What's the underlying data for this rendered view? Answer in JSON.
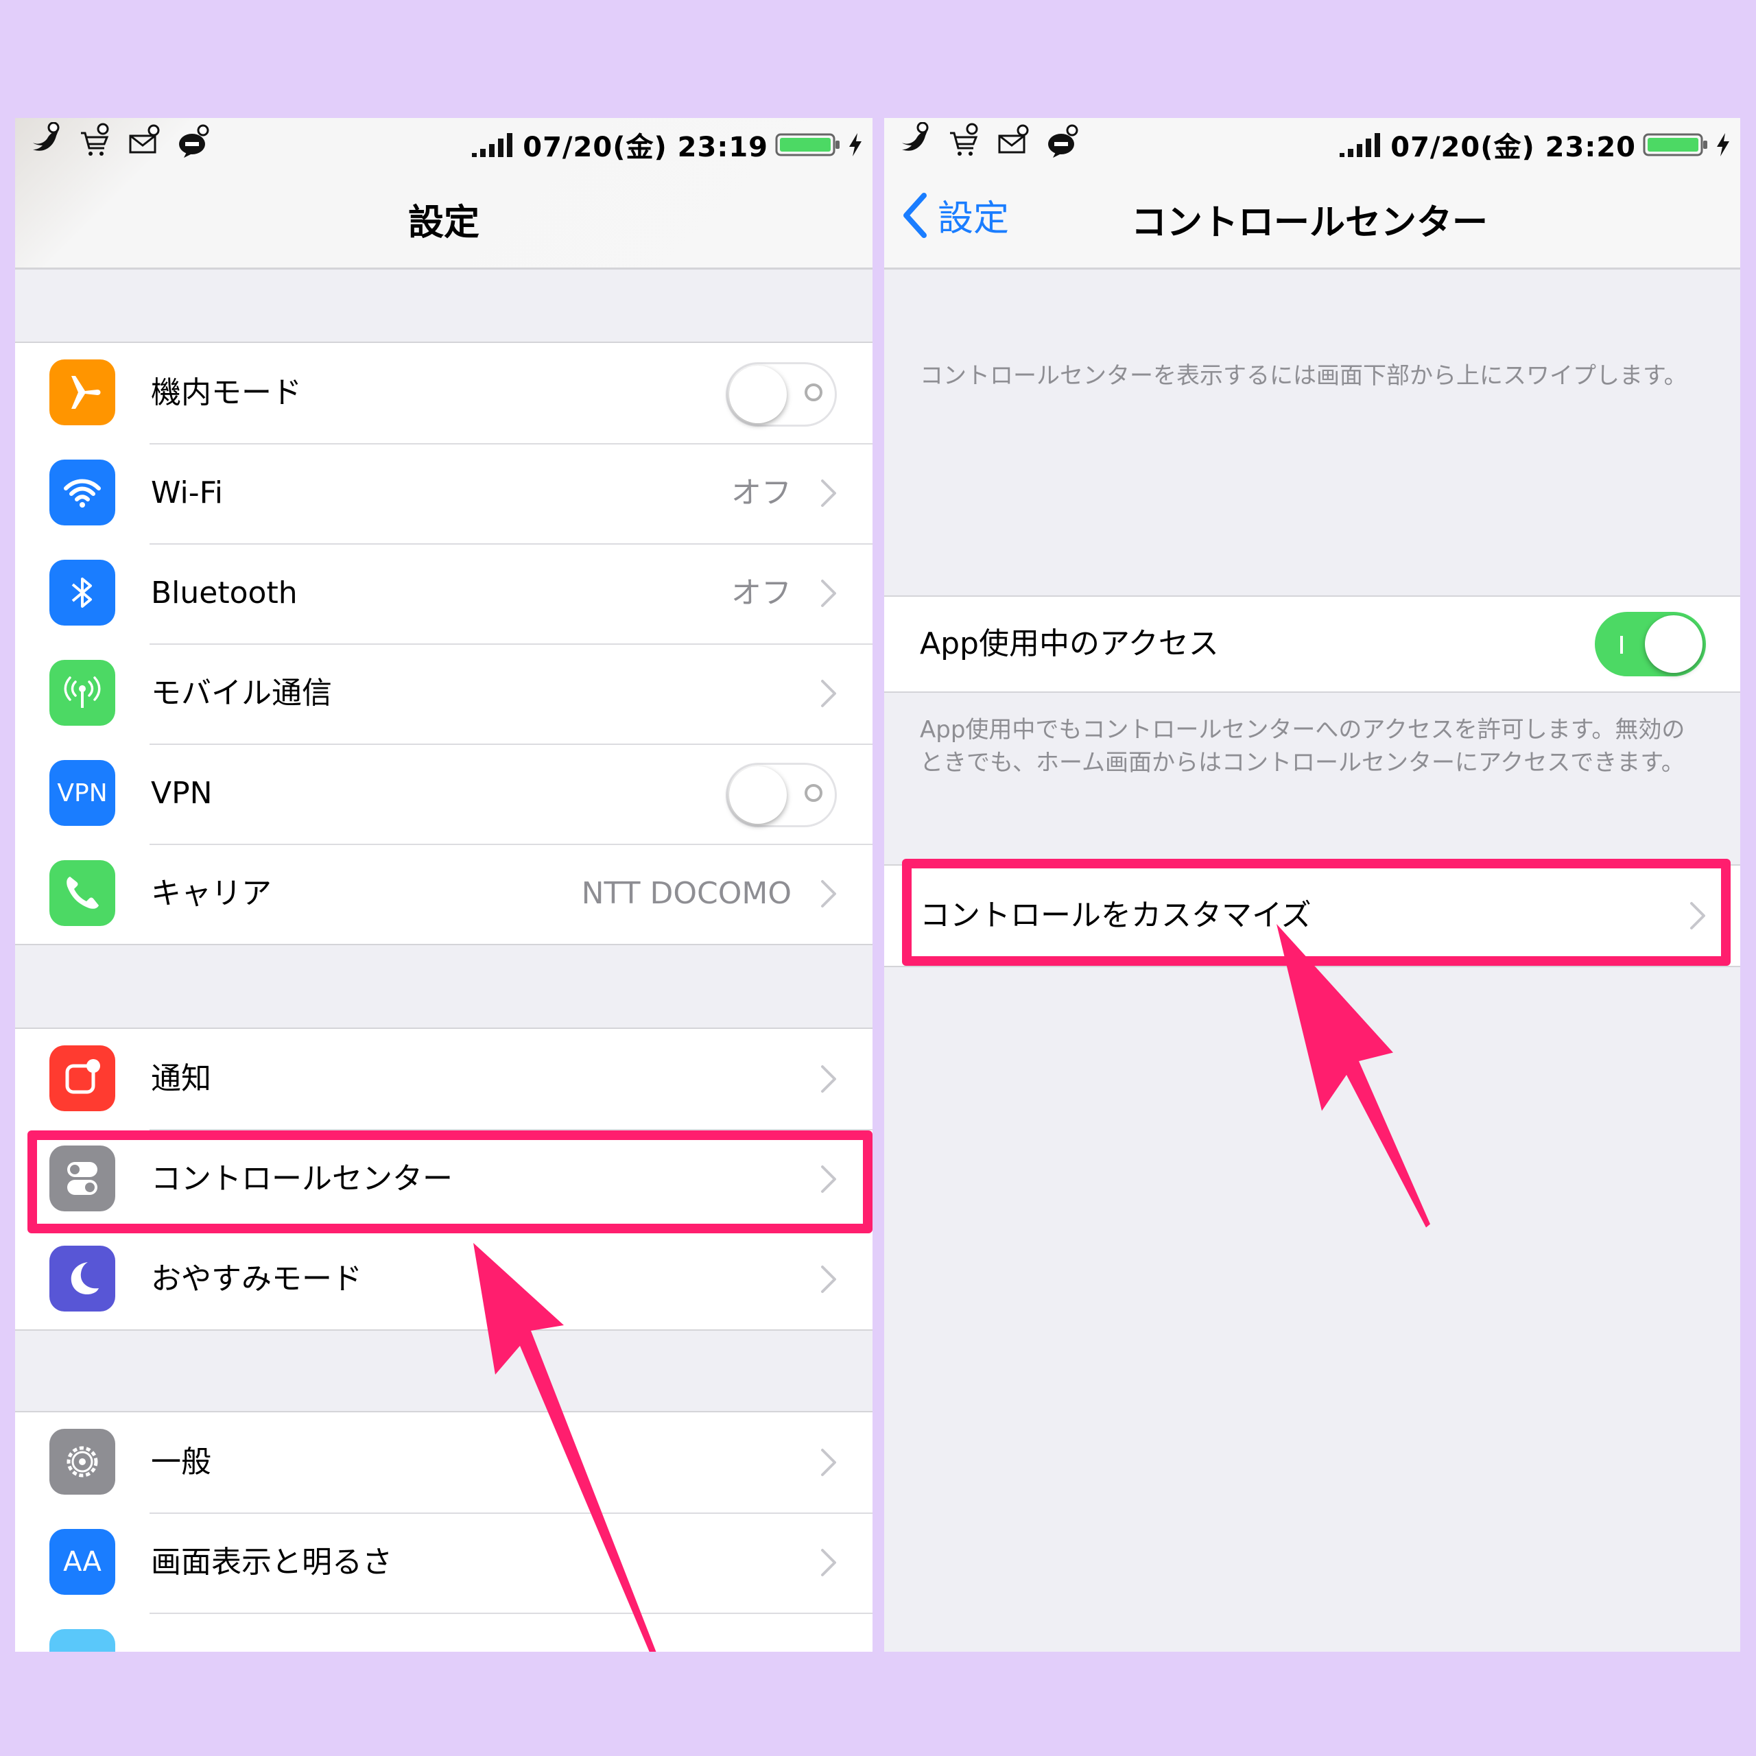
{
  "left": {
    "status": {
      "time": "07/20(金) 23:19"
    },
    "nav_title": "設定",
    "groups": [
      [
        {
          "label": "機内モード",
          "icon": "airplane-icon",
          "color": "#ff9500",
          "toggle": "off"
        },
        {
          "label": "Wi-Fi",
          "icon": "wifi-icon",
          "color": "#1a7dff",
          "detail": "オフ"
        },
        {
          "label": "Bluetooth",
          "icon": "bluetooth-icon",
          "color": "#1a7dff",
          "detail": "オフ"
        },
        {
          "label": "モバイル通信",
          "icon": "antenna-icon",
          "color": "#4cd964"
        },
        {
          "label": "VPN",
          "icon": "vpn-icon",
          "icon_text": "VPN",
          "color": "#1a7dff",
          "toggle": "off"
        },
        {
          "label": "キャリア",
          "icon": "phone-icon",
          "color": "#4cd964",
          "detail": "NTT DOCOMO"
        }
      ],
      [
        {
          "label": "通知",
          "icon": "notification-icon",
          "color": "#ff3b30"
        },
        {
          "label": "コントロールセンター",
          "icon": "control-center-icon",
          "color": "#8e8e93"
        },
        {
          "label": "おやすみモード",
          "icon": "moon-icon",
          "color": "#5856d6"
        }
      ],
      [
        {
          "label": "一般",
          "icon": "gear-icon",
          "color": "#8e8e93"
        },
        {
          "label": "画面表示と明るさ",
          "icon": "text-size-icon",
          "icon_text": "AA",
          "color": "#1a7dff"
        }
      ]
    ]
  },
  "right": {
    "status": {
      "time": "07/20(金) 23:20"
    },
    "back_label": "設定",
    "nav_title": "コントロールセンター",
    "intro": "コントロールセンターを表示するには画面下部から上にスワイプします。",
    "access_label": "App使用中のアクセス",
    "access_toggle": "on",
    "access_note": "App使用中でもコントロールセンターへのアクセスを許可します。無効のときでも、ホーム画面からはコントロールセンターにアクセスできます。",
    "customize_label": "コントロールをカスタマイズ"
  },
  "colors": {
    "highlight": "#ff1e6e",
    "background": "#e2cefa",
    "ios_blue": "#1a7dff",
    "ios_green": "#4cd964"
  }
}
